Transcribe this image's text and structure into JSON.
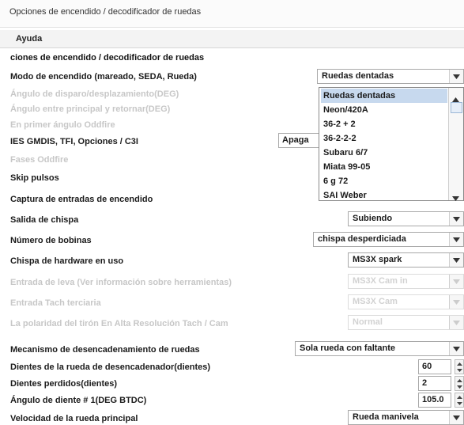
{
  "window": {
    "title": "Opciones de encendido / decodificador de ruedas"
  },
  "menubar": {
    "help_label": "Ayuda"
  },
  "section_title": "ciones de encendido / decodificador de ruedas",
  "rows": [
    {
      "label": "Modo de encendido (mareado, SEDA, Rueda)",
      "enabled": true,
      "value": "Ruedas dentadas"
    },
    {
      "label": "Ángulo de disparo/desplazamiento(DEG)",
      "enabled": false
    },
    {
      "label": "Ángulo entre principal y retornar(DEG)",
      "enabled": false
    },
    {
      "label": "En primer ángulo Oddfire",
      "enabled": false
    },
    {
      "label": "IES GMDIS, TFI, Opciones / C3I",
      "enabled": true,
      "value": "Apaga"
    },
    {
      "label": "Fases Oddfire",
      "enabled": false
    },
    {
      "label": "Skip pulsos",
      "enabled": true
    },
    {
      "label": "Captura de entradas de encendido",
      "enabled": true
    },
    {
      "label": "Salida de chispa",
      "enabled": true,
      "value": "Subiendo"
    },
    {
      "label": "Número de bobinas",
      "enabled": true,
      "value": "chispa desperdiciada"
    },
    {
      "label": "Chispa de hardware en uso",
      "enabled": true,
      "value": "MS3X spark"
    },
    {
      "label": "Entrada de leva (Ver información sobre herramientas)",
      "enabled": false,
      "value": "MS3X Cam in"
    },
    {
      "label": "Entrada Tach terciaria",
      "enabled": false,
      "value": "MS3X Cam"
    },
    {
      "label": "La polaridad del tirón En Alta Resolución Tach / Cam",
      "enabled": false,
      "value": "Normal"
    },
    {
      "label": "Mecanismo de desencadenamiento de ruedas",
      "enabled": true,
      "value": "Sola rueda con faltante"
    },
    {
      "label": "Dientes de la rueda de desencadenador(dientes)",
      "enabled": true,
      "value": "60"
    },
    {
      "label": "Dientes perdidos(dientes)",
      "enabled": true,
      "value": "2"
    },
    {
      "label": "Ángulo de diente # 1(DEG BTDC)",
      "enabled": true,
      "value": "105.0"
    },
    {
      "label": "Velocidad de la rueda principal",
      "enabled": true,
      "value": "Rueda manivela"
    }
  ],
  "dropdown": {
    "selected_index": 0,
    "options": [
      "Ruedas dentadas",
      "Neon/420A",
      "36-2 + 2",
      "36-2-2-2",
      "Subaru 6/7",
      "Miata 99-05",
      "6 g 72",
      "SAI Weber"
    ]
  },
  "icons": {
    "combo_arrow": "chevron-down-icon",
    "spinner": "spinner-arrows-icon"
  }
}
